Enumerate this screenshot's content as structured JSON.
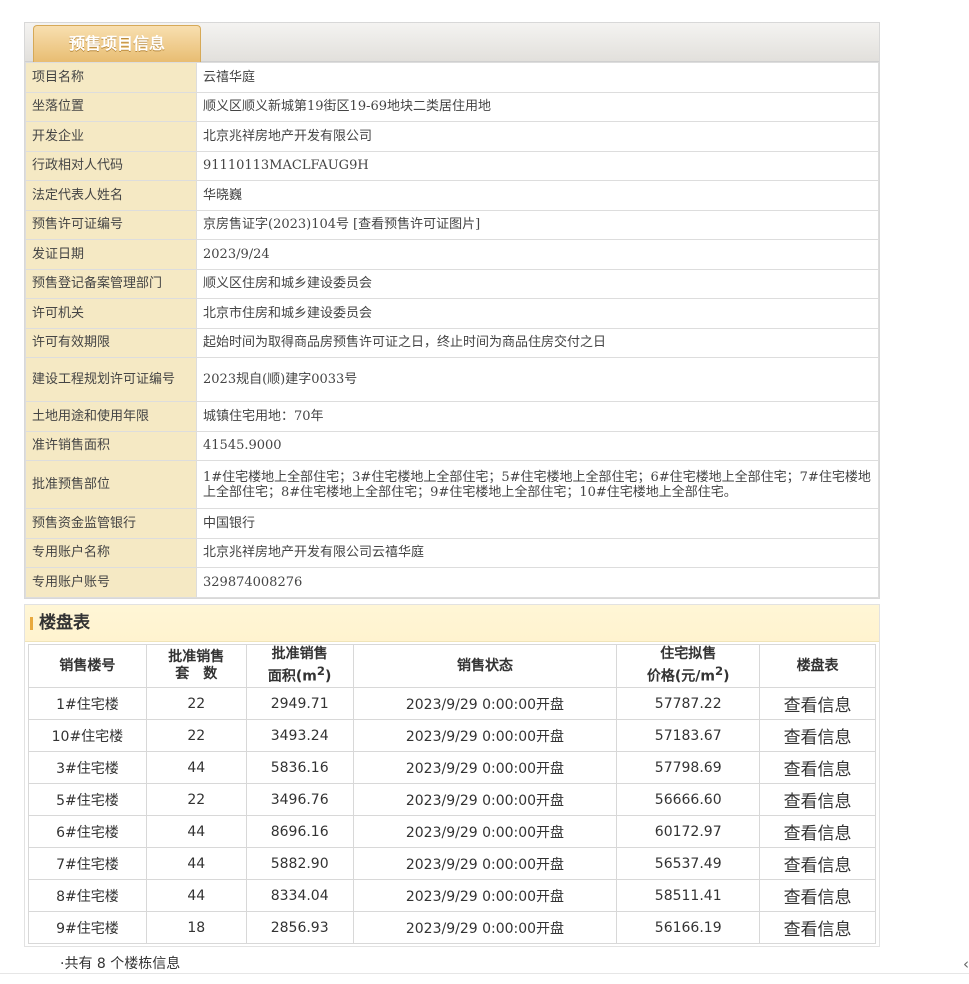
{
  "header": {
    "tab_label": "预售项目信息"
  },
  "info_rows": [
    {
      "key": "项目名称",
      "value": "云禧华庭"
    },
    {
      "key": "坐落位置",
      "value": "顺义区顺义新城第19街区19-69地块二类居住用地"
    },
    {
      "key": "开发企业",
      "value": "北京兆祥房地产开发有限公司"
    },
    {
      "key": "行政相对人代码",
      "value": "91110113MACLFAUG9H"
    },
    {
      "key": "法定代表人姓名",
      "value": "华晓巍"
    },
    {
      "key": "预售许可证编号",
      "value": "京房售证字(2023)104号",
      "link": "[查看预售许可证图片]"
    },
    {
      "key": "发证日期",
      "value": "2023/9/24"
    },
    {
      "key": "预售登记备案管理部门",
      "value": "顺义区住房和城乡建设委员会"
    },
    {
      "key": "许可机关",
      "value": "北京市住房和城乡建设委员会"
    },
    {
      "key": "许可有效期限",
      "value": "起始时间为取得商品房预售许可证之日，终止时间为商品住房交付之日"
    },
    {
      "key": "建设工程规划许可证编号",
      "value": "2023规自(顺)建字0033号"
    },
    {
      "key": "土地用途和使用年限",
      "value": "城镇住宅用地：70年"
    },
    {
      "key": "准许销售面积",
      "value": "41545.9000"
    },
    {
      "key": "批准预售部位",
      "value": "1#住宅楼地上全部住宅；3#住宅楼地上全部住宅；5#住宅楼地上全部住宅；6#住宅楼地上全部住宅；7#住宅楼地上全部住宅；8#住宅楼地上全部住宅；9#住宅楼地上全部住宅；10#住宅楼地上全部住宅。"
    },
    {
      "key": "预售资金监管银行",
      "value": "中国银行"
    },
    {
      "key": "专用账户名称",
      "value": "北京兆祥房地产开发有限公司云禧华庭"
    },
    {
      "key": "专用账户账号",
      "value": "329874008276"
    }
  ],
  "building_table": {
    "title": "楼盘表",
    "columns": {
      "c1": "销售楼号",
      "c2a": "批准销售",
      "c2b": "套　数",
      "c3a": "批准销售",
      "c3b": "面积(m",
      "c3sup": "2",
      "c3c": ")",
      "c4": "销售状态",
      "c5a": "住宅拟售",
      "c5b": "价格(元/m",
      "c5sup": "2",
      "c5c": ")",
      "c6": "楼盘表"
    },
    "rows": [
      {
        "building": "1#住宅楼",
        "units": "22",
        "area": "2949.71",
        "status": "2023/9/29 0:00:00开盘",
        "price": "57787.22",
        "link": "查看信息"
      },
      {
        "building": "10#住宅楼",
        "units": "22",
        "area": "3493.24",
        "status": "2023/9/29 0:00:00开盘",
        "price": "57183.67",
        "link": "查看信息"
      },
      {
        "building": "3#住宅楼",
        "units": "44",
        "area": "5836.16",
        "status": "2023/9/29 0:00:00开盘",
        "price": "57798.69",
        "link": "查看信息"
      },
      {
        "building": "5#住宅楼",
        "units": "22",
        "area": "3496.76",
        "status": "2023/9/29 0:00:00开盘",
        "price": "56666.60",
        "link": "查看信息"
      },
      {
        "building": "6#住宅楼",
        "units": "44",
        "area": "8696.16",
        "status": "2023/9/29 0:00:00开盘",
        "price": "60172.97",
        "link": "查看信息"
      },
      {
        "building": "7#住宅楼",
        "units": "44",
        "area": "5882.90",
        "status": "2023/9/29 0:00:00开盘",
        "price": "56537.49",
        "link": "查看信息"
      },
      {
        "building": "8#住宅楼",
        "units": "44",
        "area": "8334.04",
        "status": "2023/9/29 0:00:00开盘",
        "price": "58511.41",
        "link": "查看信息"
      },
      {
        "building": "9#住宅楼",
        "units": "18",
        "area": "2856.93",
        "status": "2023/9/29 0:00:00开盘",
        "price": "56166.19",
        "link": "查看信息"
      }
    ],
    "count_note": "·共有 8 个楼栋信息"
  },
  "icons": {
    "side_arrow": "chevron-left-icon"
  }
}
